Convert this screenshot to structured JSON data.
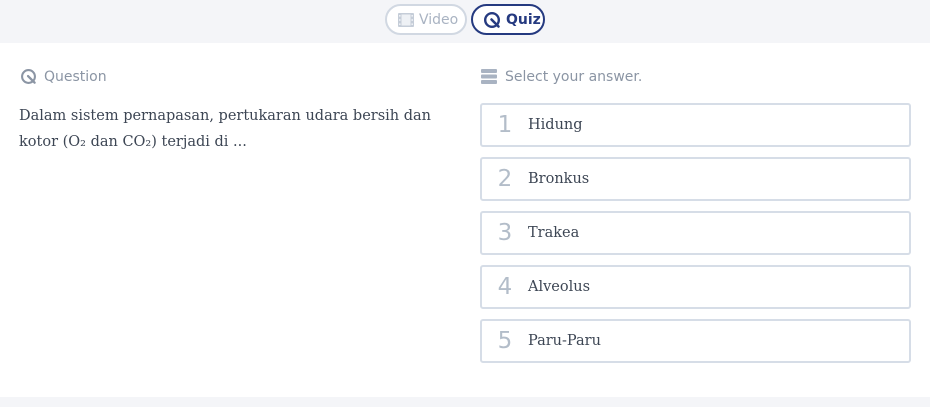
{
  "tabs": {
    "video_label": "Video",
    "quiz_label": "Quiz"
  },
  "question": {
    "header": "Question",
    "text": "Dalam sistem pernapasan, pertukaran udara bersih dan kotor (O₂ dan CO₂) terjadi di ..."
  },
  "answers": {
    "header": "Select your answer.",
    "options": [
      {
        "number": "1",
        "label": "Hidung"
      },
      {
        "number": "2",
        "label": "Bronkus"
      },
      {
        "number": "3",
        "label": "Trakea"
      },
      {
        "number": "4",
        "label": "Alveolus"
      },
      {
        "number": "5",
        "label": "Paru-Paru"
      }
    ]
  },
  "colors": {
    "accent": "#253a80",
    "muted": "#a9b3c2",
    "border": "#d6dde7",
    "bar_bg": "#f4f5f8"
  },
  "icons": {
    "video": "film-icon",
    "quiz": "quiz-icon",
    "question": "quiz-icon",
    "answer": "list-icon"
  }
}
